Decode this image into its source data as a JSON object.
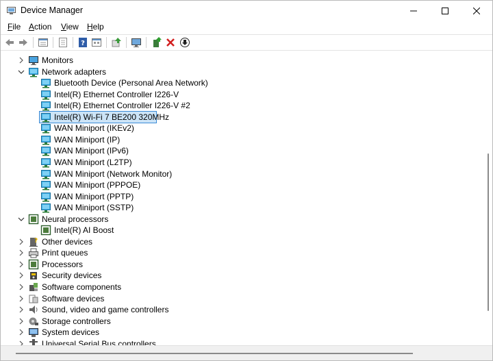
{
  "window": {
    "title": "Device Manager"
  },
  "menu": {
    "file": "File",
    "action": "Action",
    "view": "View",
    "help": "Help",
    "file_acc": "F",
    "action_acc": "A",
    "view_acc": "V",
    "help_acc": "H",
    "file_rest": "ile",
    "action_rest": "ction",
    "view_rest": "iew",
    "help_rest": "elp"
  },
  "toolbar": {
    "icons": [
      "back-icon",
      "forward-icon",
      "properties-icon",
      "show-hidden-icon",
      "help-icon",
      "view-icon",
      "update-driver-icon",
      "scan-hardware-icon",
      "add-driver-icon",
      "uninstall-icon",
      "download-icon"
    ]
  },
  "tree": {
    "rows": [
      {
        "label": "Monitors",
        "level": 0,
        "expanded": false,
        "icon": "monitor-icon"
      },
      {
        "label": "Network adapters",
        "level": 0,
        "expanded": true,
        "icon": "network-icon"
      },
      {
        "label": "Bluetooth Device (Personal Area Network)",
        "level": 1,
        "icon": "network-icon"
      },
      {
        "label": "Intel(R) Ethernet Controller I226-V",
        "level": 1,
        "icon": "network-icon"
      },
      {
        "label": "Intel(R) Ethernet Controller I226-V #2",
        "level": 1,
        "icon": "network-icon"
      },
      {
        "label": "Intel(R) Wi-Fi 7 BE200 320MHz",
        "level": 1,
        "icon": "network-icon",
        "selected": true
      },
      {
        "label": "WAN Miniport (IKEv2)",
        "level": 1,
        "icon": "network-icon"
      },
      {
        "label": "WAN Miniport (IP)",
        "level": 1,
        "icon": "network-icon"
      },
      {
        "label": "WAN Miniport (IPv6)",
        "level": 1,
        "icon": "network-icon"
      },
      {
        "label": "WAN Miniport (L2TP)",
        "level": 1,
        "icon": "network-icon"
      },
      {
        "label": "WAN Miniport (Network Monitor)",
        "level": 1,
        "icon": "network-icon"
      },
      {
        "label": "WAN Miniport (PPPOE)",
        "level": 1,
        "icon": "network-icon"
      },
      {
        "label": "WAN Miniport (PPTP)",
        "level": 1,
        "icon": "network-icon"
      },
      {
        "label": "WAN Miniport (SSTP)",
        "level": 1,
        "icon": "network-icon"
      },
      {
        "label": "Neural processors",
        "level": 0,
        "expanded": true,
        "icon": "chip-icon"
      },
      {
        "label": "Intel(R) AI Boost",
        "level": 1,
        "icon": "chip-icon"
      },
      {
        "label": "Other devices",
        "level": 0,
        "expanded": false,
        "icon": "other-device-icon"
      },
      {
        "label": "Print queues",
        "level": 0,
        "expanded": false,
        "icon": "printer-icon"
      },
      {
        "label": "Processors",
        "level": 0,
        "expanded": false,
        "icon": "chip-icon"
      },
      {
        "label": "Security devices",
        "level": 0,
        "expanded": false,
        "icon": "security-icon"
      },
      {
        "label": "Software components",
        "level": 0,
        "expanded": false,
        "icon": "software-component-icon"
      },
      {
        "label": "Software devices",
        "level": 0,
        "expanded": false,
        "icon": "software-device-icon"
      },
      {
        "label": "Sound, video and game controllers",
        "level": 0,
        "expanded": false,
        "icon": "speaker-icon"
      },
      {
        "label": "Storage controllers",
        "level": 0,
        "expanded": false,
        "icon": "storage-icon"
      },
      {
        "label": "System devices",
        "level": 0,
        "expanded": false,
        "icon": "system-icon"
      },
      {
        "label": "Universal Serial Bus controllers",
        "level": 0,
        "expanded": false,
        "icon": "usb-icon"
      }
    ]
  },
  "colors": {
    "selection_bg": "#cce4f7",
    "selection_border": "#3b8bd6",
    "network_teal": "#1a9ad6"
  }
}
